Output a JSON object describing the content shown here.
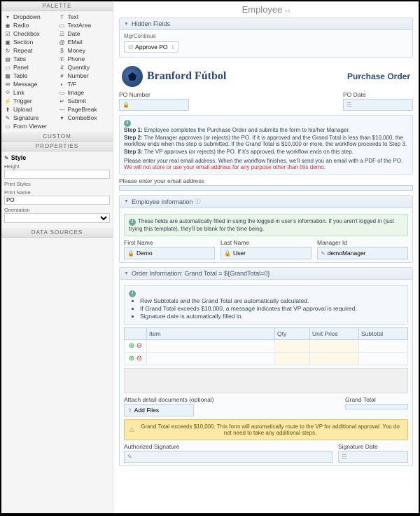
{
  "sidebar": {
    "palette_title": "PALETTE",
    "custom_title": "CUSTOM",
    "props_title": "PROPERTIES",
    "data_title": "DATA SOURCES",
    "col1": [
      "Dropdown",
      "Radio",
      "Checkbox",
      "Section",
      "Repeat",
      "Tabs",
      "Panel",
      "Table",
      "Message",
      "Link",
      "Trigger",
      "Upload",
      "Signature",
      "Form Viewer"
    ],
    "col2": [
      "Text",
      "TextArea",
      "Date",
      "EMail",
      "Money",
      "Phone",
      "Quantity",
      "Number",
      "T/F",
      "Image",
      "Submit",
      "PageBreak",
      "ComboBox"
    ],
    "style_label": "Style",
    "height_label": "Height",
    "print_styles_label": "Print Styles",
    "print_name_label": "Print Name",
    "print_name_value": "PO",
    "orientation_label": "Orientation"
  },
  "page": {
    "title": "Employee",
    "title_sub": "v6"
  },
  "hidden": {
    "title": "Hidden Fields",
    "mgr_label": "MgrContinue",
    "chip": "Approve PO"
  },
  "logo": {
    "text": "Branford Fútbol",
    "po": "Purchase Order"
  },
  "po": {
    "num_label": "PO Number",
    "date_label": "PO Date"
  },
  "steps": {
    "s1b": "Step 1:",
    "s1": "Employee completes the Purchase Order and submits the form to his/her Manager.",
    "s2b": "Step 2:",
    "s2": "The Manager approves (or rejects) the PO. If it is approved and the Grand Total is less than $10,000, the workflow ends when this step is submitted. If the Grand Total is $10,000 or more, the workflow proceeds to Step 3.",
    "s3b": "Step 3:",
    "s3": "The VP approves (or rejects) the PO. If it's approved, the workflow ends on this step.",
    "note1": "Please enter your real email address. When the workflow finishes, we'll send you an email with a PDF of the PO. ",
    "note_red": "We will not store or use your email address for any purpose other than this demo."
  },
  "email_label": "Please enter your email address",
  "emp": {
    "title": "Employee Information",
    "info": "These fields are automatically filled in using the logged-in user's information. If you aren't logged in (just trying this template), they'll be blank for the time being.",
    "fn_label": "First Name",
    "fn": "Demo",
    "ln_label": "Last Name",
    "ln": "User",
    "mgr_label": "Manager Id",
    "mgr": "demoManager"
  },
  "order": {
    "title": "Order Information: Grand Total = ${GrandTotal=0}",
    "b1": "Row Subtotals and the Grand Total are automatically calculated.",
    "b2": "If Grand Total exceeds $10,000, a message indicates that VP approval is required.",
    "b3": "Signature date is automatically filled in.",
    "cols": {
      "item": "Item",
      "qty": "Qty",
      "price": "Unit Price",
      "sub": "Subtotal"
    },
    "attach_label": "Attach detail documents (optional)",
    "add_files": "Add Files",
    "gt_label": "Grand Total",
    "warn": "Grand Total exceeds $10,000. This form will automatically route to the VP for additional approval. You do not need to take any additional steps.",
    "sig_label": "Authorized Signature",
    "sigdate_label": "Signature Date"
  }
}
